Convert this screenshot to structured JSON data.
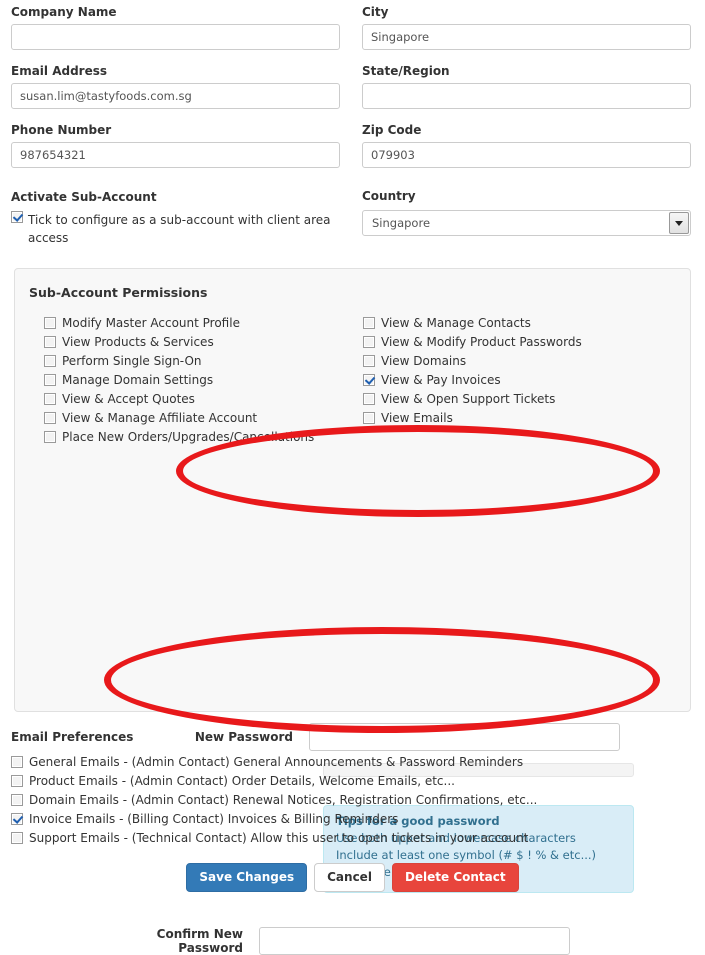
{
  "form": {
    "left_fields": [
      {
        "label": "Company Name",
        "value": "",
        "name": "company-name"
      },
      {
        "label": "Email Address",
        "value": "susan.lim@tastyfoods.com.sg",
        "name": "email-address"
      },
      {
        "label": "Phone Number",
        "value": "987654321",
        "name": "phone-number"
      }
    ],
    "right_fields": [
      {
        "label": "City",
        "value": "Singapore",
        "name": "city"
      },
      {
        "label": "State/Region",
        "value": "",
        "name": "state-region"
      },
      {
        "label": "Zip Code",
        "value": "079903",
        "name": "zip-code"
      }
    ],
    "country": {
      "label": "Country",
      "selected": "Singapore",
      "options": [
        "Singapore"
      ]
    }
  },
  "activate": {
    "label": "Activate Sub-Account",
    "checkbox_label": "Tick to configure as a sub-account with client area access",
    "checked": true
  },
  "permissions": {
    "title": "Sub-Account Permissions",
    "left": [
      {
        "label": "Modify Master Account Profile",
        "checked": false
      },
      {
        "label": "View Products & Services",
        "checked": false
      },
      {
        "label": "Perform Single Sign-On",
        "checked": false
      },
      {
        "label": "Manage Domain Settings",
        "checked": false
      },
      {
        "label": "View & Accept Quotes",
        "checked": false
      },
      {
        "label": "View & Manage Affiliate Account",
        "checked": false
      },
      {
        "label": "Place New Orders/Upgrades/Cancellations",
        "checked": false
      }
    ],
    "right": [
      {
        "label": "View & Manage Contacts",
        "checked": false
      },
      {
        "label": "View & Modify Product Passwords",
        "checked": false
      },
      {
        "label": "View Domains",
        "checked": false
      },
      {
        "label": "View & Pay Invoices",
        "checked": true
      },
      {
        "label": "View & Open Support Tickets",
        "checked": false
      },
      {
        "label": "View Emails",
        "checked": false
      }
    ]
  },
  "password": {
    "new_label": "New Password",
    "new_value": "",
    "confirm_label": "Confirm New Password",
    "confirm_value": "",
    "strength_percent": 0,
    "tips": {
      "title": "Tips for a good password",
      "lines": [
        "Use both upper and lowercase characters",
        "Include at least one symbol (# $ ! % & etc...)",
        "Don't use dictionary words"
      ]
    }
  },
  "email_preferences": {
    "title": "Email Preferences",
    "items": [
      {
        "label": "General Emails - (Admin Contact) General Announcements & Password Reminders",
        "checked": false
      },
      {
        "label": "Product Emails - (Admin Contact) Order Details, Welcome Emails, etc...",
        "checked": false
      },
      {
        "label": "Domain Emails - (Admin Contact) Renewal Notices, Registration Confirmations, etc...",
        "checked": false
      },
      {
        "label": "Invoice Emails - (Billing Contact) Invoices & Billing Reminders",
        "checked": true
      },
      {
        "label": "Support Emails - (Technical Contact) Allow this user to open tickets in your account",
        "checked": false
      }
    ]
  },
  "buttons": {
    "save": "Save Changes",
    "cancel": "Cancel",
    "delete": "Delete Contact"
  },
  "annotations": {
    "color": "#e8191b",
    "ovals": [
      "new-password-highlight",
      "confirm-password-highlight"
    ]
  }
}
